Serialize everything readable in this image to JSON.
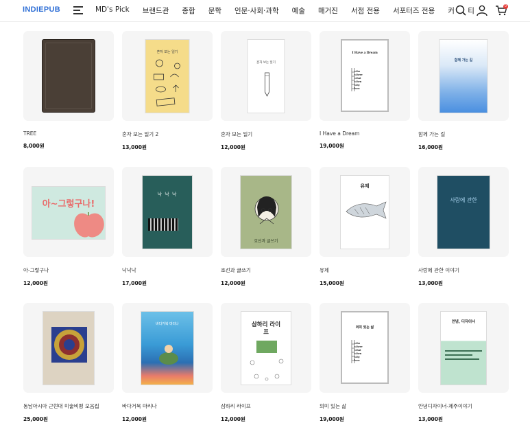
{
  "header": {
    "logo": "INDIEPUB",
    "nav": [
      "MD's Pick",
      "브랜드관",
      "종합",
      "문학",
      "인문·사회·과학",
      "예술",
      "매거진",
      "서점 전용",
      "서포터즈 전용",
      "커뮤니티"
    ],
    "cart_count": "0"
  },
  "products": [
    {
      "title": "TREE",
      "price": "8,000원",
      "cover_text": ""
    },
    {
      "title": "혼자 보는 일기 2",
      "price": "13,000원",
      "cover_text": "혼자 보는 일기"
    },
    {
      "title": "혼자 보는 일기",
      "price": "12,000원",
      "cover_text": "혼자 보는 일기"
    },
    {
      "title": "I Have a Dream",
      "price": "19,000원",
      "cover_text": "I Have a Dream"
    },
    {
      "title": "함께 가는 길",
      "price": "16,000원",
      "cover_text": "함께 가는 길"
    },
    {
      "title": "아-그렇구나",
      "price": "12,000원",
      "cover_text": "아~그렇구나!"
    },
    {
      "title": "낙낙낙",
      "price": "17,000원",
      "cover_text": "낙 낙 낙"
    },
    {
      "title": "호선과 글쓰기",
      "price": "12,000원",
      "cover_text": "호선과 글쓰기"
    },
    {
      "title": "유제",
      "price": "15,000원",
      "cover_text": "유제"
    },
    {
      "title": "사랑에 관한 이야기",
      "price": "13,000원",
      "cover_text": "사랑에 관한"
    },
    {
      "title": "동남아시아 근현대 미술비평 모음집",
      "price": "25,000원",
      "cover_text": ""
    },
    {
      "title": "바다거북 마리나",
      "price": "12,000원",
      "cover_text": "바다거북 마리나"
    },
    {
      "title": "삼하리 라이프",
      "price": "12,000원",
      "cover_text": "삼하리 라이프"
    },
    {
      "title": "의미 있는 삶",
      "price": "19,000원",
      "cover_text": "의미 있는 삶"
    },
    {
      "title": "안녕디자이너-제주이야기",
      "price": "13,000원",
      "cover_text": "안녕, 디자이너"
    }
  ],
  "colors": {
    "accent": "#2f6fd6",
    "badge": "#e53935"
  }
}
